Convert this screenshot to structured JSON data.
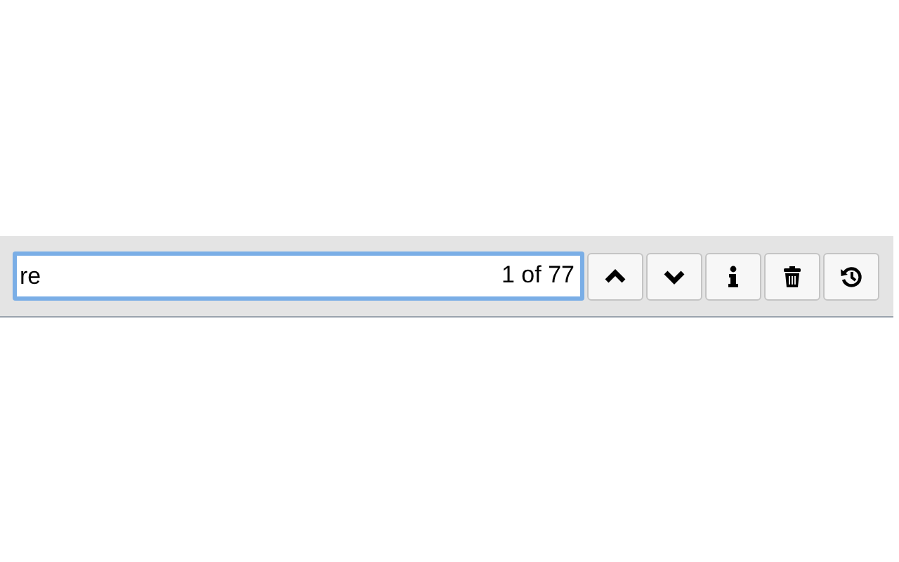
{
  "search": {
    "value": "re",
    "match_count": "1 of 77",
    "focused": true
  },
  "buttons": [
    {
      "kind": "up"
    },
    {
      "kind": "down"
    },
    {
      "kind": "info"
    },
    {
      "kind": "trash"
    },
    {
      "kind": "history"
    }
  ]
}
